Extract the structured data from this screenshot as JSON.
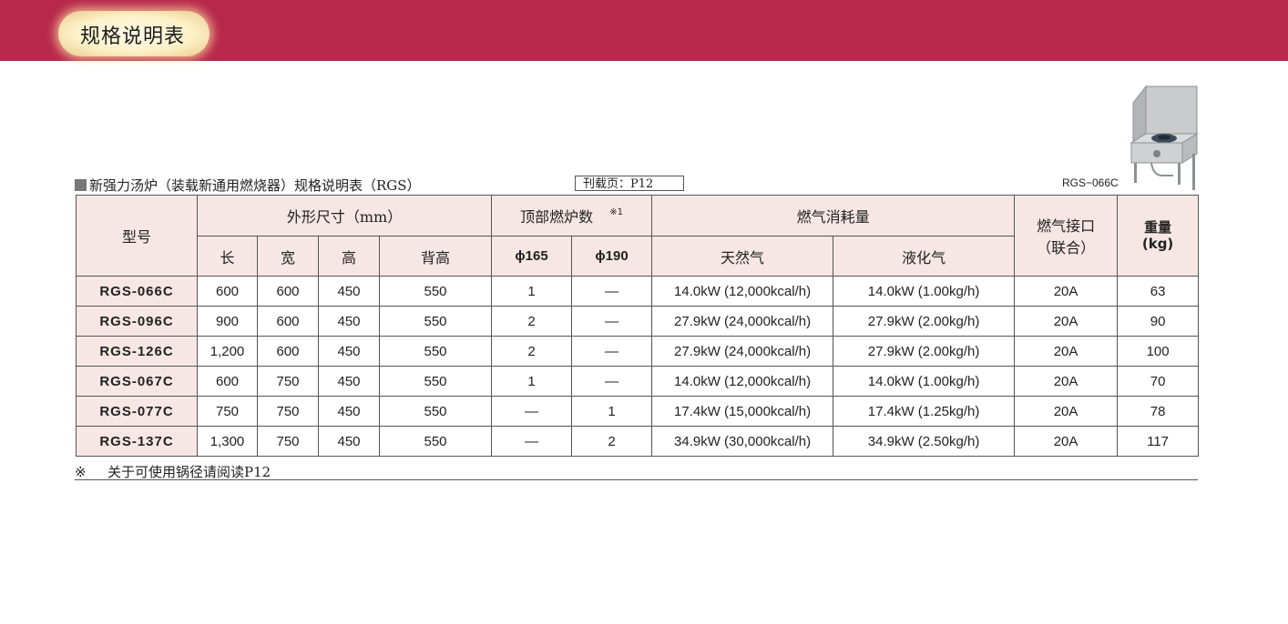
{
  "banner": {
    "title": "规格说明表",
    "color": "#b8284a"
  },
  "section": {
    "title": "新强力汤炉（装载新通用燃烧器）规格说明表（RGS）",
    "ref": "刊载页：P12"
  },
  "product": {
    "label": "RGS−066C"
  },
  "table": {
    "headers": {
      "model": "型号",
      "dimensions": "外形尺寸（mm）",
      "length": "长",
      "width": "宽",
      "height": "高",
      "back_height": "背高",
      "burners": "顶部燃炉数",
      "burners_note": "※1",
      "phi165": "ϕ165",
      "phi190": "ϕ190",
      "gas": "燃气消耗量",
      "natural_gas": "天然气",
      "lpg": "液化气",
      "connector": "燃气接口",
      "connector_sub": "（联合）",
      "weight": "重量",
      "weight_unit": "(kg)"
    },
    "rows": [
      {
        "model": "RGS-066C",
        "length": "600",
        "width": "600",
        "height": "450",
        "back_height": "550",
        "phi165": "1",
        "phi190": "—",
        "natural_gas": "14.0kW (12,000kcal/h)",
        "lpg": "14.0kW (1.00kg/h)",
        "connector": "20A",
        "weight": "63"
      },
      {
        "model": "RGS-096C",
        "length": "900",
        "width": "600",
        "height": "450",
        "back_height": "550",
        "phi165": "2",
        "phi190": "—",
        "natural_gas": "27.9kW (24,000kcal/h)",
        "lpg": "27.9kW (2.00kg/h)",
        "connector": "20A",
        "weight": "90"
      },
      {
        "model": "RGS-126C",
        "length": "1,200",
        "width": "600",
        "height": "450",
        "back_height": "550",
        "phi165": "2",
        "phi190": "—",
        "natural_gas": "27.9kW (24,000kcal/h)",
        "lpg": "27.9kW (2.00kg/h)",
        "connector": "20A",
        "weight": "100"
      },
      {
        "model": "RGS-067C",
        "length": "600",
        "width": "750",
        "height": "450",
        "back_height": "550",
        "phi165": "1",
        "phi190": "—",
        "natural_gas": "14.0kW (12,000kcal/h)",
        "lpg": "14.0kW (1.00kg/h)",
        "connector": "20A",
        "weight": "70"
      },
      {
        "model": "RGS-077C",
        "length": "750",
        "width": "750",
        "height": "450",
        "back_height": "550",
        "phi165": "—",
        "phi190": "1",
        "natural_gas": "17.4kW (15,000kcal/h)",
        "lpg": "17.4kW (1.25kg/h)",
        "connector": "20A",
        "weight": "78"
      },
      {
        "model": "RGS-137C",
        "length": "1,300",
        "width": "750",
        "height": "450",
        "back_height": "550",
        "phi165": "—",
        "phi190": "2",
        "natural_gas": "34.9kW (30,000kcal/h)",
        "lpg": "34.9kW (2.50kg/h)",
        "connector": "20A",
        "weight": "117"
      }
    ]
  },
  "note": {
    "mark": "※",
    "text": "关于可使用锅径请阅读P12"
  }
}
